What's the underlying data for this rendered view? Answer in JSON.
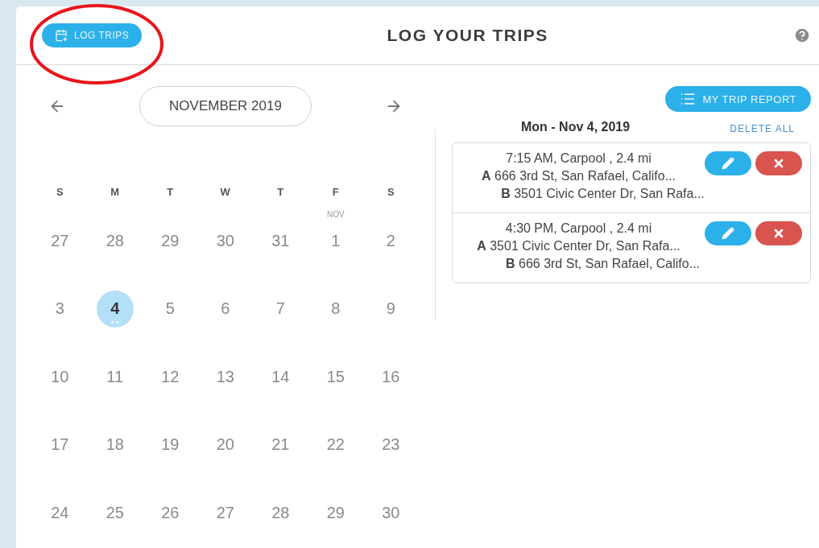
{
  "header": {
    "log_button": "LOG TRIPS",
    "title": "LOG YOUR TRIPS"
  },
  "annotation": {
    "kind": "ellipse"
  },
  "calendar": {
    "month": "NOVEMBER 2019",
    "weekdays": [
      "S",
      "M",
      "T",
      "W",
      "T",
      "F",
      "S"
    ],
    "days": [
      {
        "day": "27",
        "selected": false,
        "has_trips": false
      },
      {
        "day": "28",
        "selected": false,
        "has_trips": false
      },
      {
        "day": "29",
        "selected": false,
        "has_trips": false
      },
      {
        "day": "30",
        "selected": false,
        "has_trips": false
      },
      {
        "day": "31",
        "selected": false,
        "has_trips": false
      },
      {
        "day": "1",
        "month_label": "NOV",
        "selected": false,
        "has_trips": false
      },
      {
        "day": "2",
        "selected": false,
        "has_trips": false
      },
      {
        "day": "3",
        "selected": false,
        "has_trips": false
      },
      {
        "day": "4",
        "selected": true,
        "has_trips": true
      },
      {
        "day": "5",
        "selected": false,
        "has_trips": false
      },
      {
        "day": "6",
        "selected": false,
        "has_trips": false
      },
      {
        "day": "7",
        "selected": false,
        "has_trips": false
      },
      {
        "day": "8",
        "selected": false,
        "has_trips": false
      },
      {
        "day": "9",
        "selected": false,
        "has_trips": false
      },
      {
        "day": "10",
        "selected": false,
        "has_trips": false
      },
      {
        "day": "11",
        "selected": false,
        "has_trips": false
      },
      {
        "day": "12",
        "selected": false,
        "has_trips": false
      },
      {
        "day": "13",
        "selected": false,
        "has_trips": false
      },
      {
        "day": "14",
        "selected": false,
        "has_trips": false
      },
      {
        "day": "15",
        "selected": false,
        "has_trips": false
      },
      {
        "day": "16",
        "selected": false,
        "has_trips": false
      },
      {
        "day": "17",
        "selected": false,
        "has_trips": false
      },
      {
        "day": "18",
        "selected": false,
        "has_trips": false
      },
      {
        "day": "19",
        "selected": false,
        "has_trips": false
      },
      {
        "day": "20",
        "selected": false,
        "has_trips": false
      },
      {
        "day": "21",
        "selected": false,
        "has_trips": false
      },
      {
        "day": "22",
        "selected": false,
        "has_trips": false
      },
      {
        "day": "23",
        "selected": false,
        "has_trips": false
      },
      {
        "day": "24",
        "selected": false,
        "has_trips": false
      },
      {
        "day": "25",
        "selected": false,
        "has_trips": false
      },
      {
        "day": "26",
        "selected": false,
        "has_trips": false
      },
      {
        "day": "27",
        "selected": false,
        "has_trips": false
      },
      {
        "day": "28",
        "selected": false,
        "has_trips": false
      },
      {
        "day": "29",
        "selected": false,
        "has_trips": false
      },
      {
        "day": "30",
        "selected": false,
        "has_trips": false
      }
    ]
  },
  "trips": {
    "report_button": "MY TRIP REPORT",
    "date": "Mon - Nov 4, 2019",
    "delete_all": "DELETE ALL",
    "items": [
      {
        "summary": "7:15 AM, Carpool , 2.4 mi",
        "from_label": "A",
        "from": "666 3rd St, San Rafael, Califo...",
        "to_label": "B",
        "to": "3501 Civic Center Dr, San Rafa..."
      },
      {
        "summary": "4:30 PM, Carpool , 2.4 mi",
        "from_label": "A",
        "from": "3501 Civic Center Dr, San Rafa...",
        "to_label": "B",
        "to": "666 3rd St, San Rafael, Califo..."
      }
    ]
  }
}
